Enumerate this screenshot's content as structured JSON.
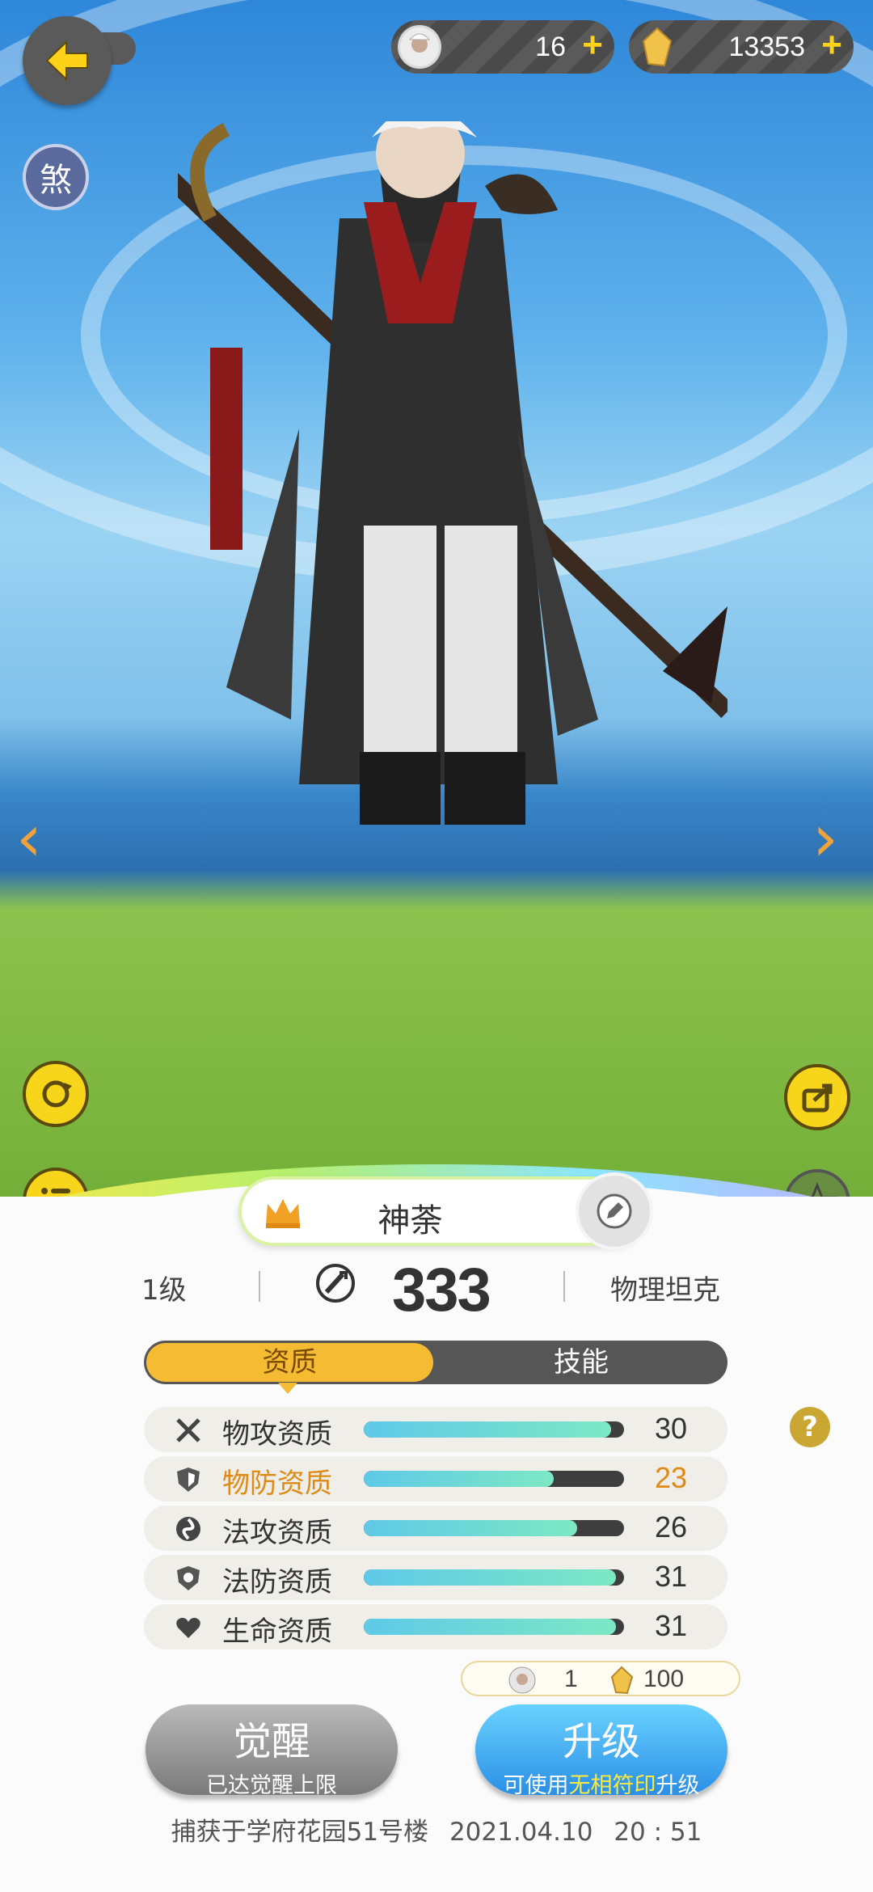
{
  "header": {
    "currency_1": {
      "value": "16",
      "icon": "avatar-token-icon"
    },
    "currency_2": {
      "value": "13353",
      "icon": "gold-crystal-icon"
    },
    "sha_badge": "煞"
  },
  "pet": {
    "name": "神荼",
    "level": "1级",
    "power": "333",
    "role": "物理坦克"
  },
  "tabs": [
    {
      "label": "资质",
      "active": true
    },
    {
      "label": "技能",
      "active": false
    }
  ],
  "attributes": [
    {
      "label": "物攻资质",
      "value": "30",
      "fill": 0.95,
      "icon": "swords-icon",
      "highlight": false
    },
    {
      "label": "物防资质",
      "value": "23",
      "fill": 0.73,
      "icon": "shield-icon",
      "highlight": true
    },
    {
      "label": "法攻资质",
      "value": "26",
      "fill": 0.82,
      "icon": "magic-orb-icon",
      "highlight": false
    },
    {
      "label": "法防资质",
      "value": "31",
      "fill": 0.97,
      "icon": "magic-shield-icon",
      "highlight": false
    },
    {
      "label": "生命资质",
      "value": "31",
      "fill": 0.97,
      "icon": "heart-icon",
      "highlight": false
    }
  ],
  "cost": {
    "item_1": "1",
    "item_2": "100"
  },
  "buttons": {
    "awaken": {
      "title": "觉醒",
      "sub": "已达觉醒上限"
    },
    "upgrade": {
      "title": "升级",
      "sub_pre": "可使用",
      "sub_hl": "无相符印",
      "sub_post": "升级"
    }
  },
  "footer": {
    "location": "捕获于学府花园51号楼",
    "date": "2021.04.10",
    "time": "20 : 51"
  },
  "colors": {
    "accent": "#f4bb33",
    "highlight": "#e08a16",
    "bar_fill": "#6fd8d6",
    "upgrade": "#3aa6f0"
  }
}
